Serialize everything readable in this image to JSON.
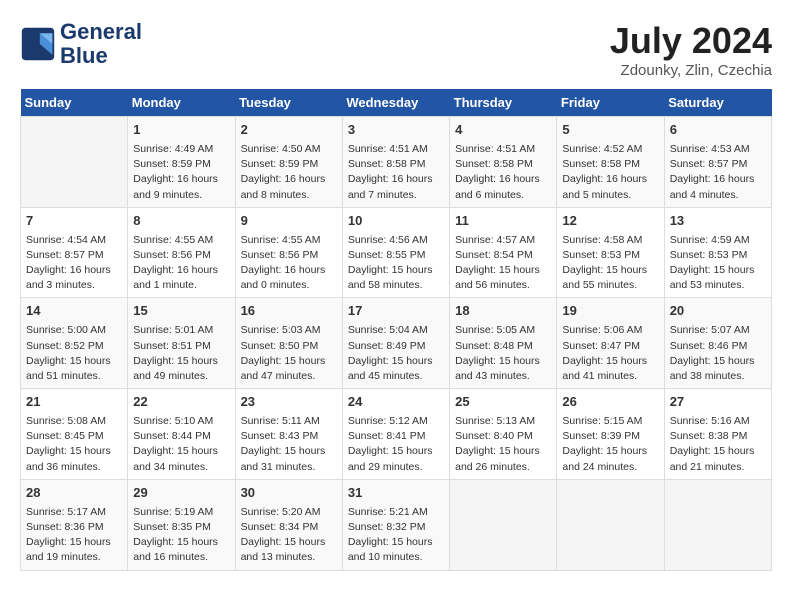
{
  "header": {
    "logo_line1": "General",
    "logo_line2": "Blue",
    "month": "July 2024",
    "location": "Zdounky, Zlin, Czechia"
  },
  "columns": [
    "Sunday",
    "Monday",
    "Tuesday",
    "Wednesday",
    "Thursday",
    "Friday",
    "Saturday"
  ],
  "weeks": [
    [
      {
        "day": "",
        "info": ""
      },
      {
        "day": "1",
        "info": "Sunrise: 4:49 AM\nSunset: 8:59 PM\nDaylight: 16 hours\nand 9 minutes."
      },
      {
        "day": "2",
        "info": "Sunrise: 4:50 AM\nSunset: 8:59 PM\nDaylight: 16 hours\nand 8 minutes."
      },
      {
        "day": "3",
        "info": "Sunrise: 4:51 AM\nSunset: 8:58 PM\nDaylight: 16 hours\nand 7 minutes."
      },
      {
        "day": "4",
        "info": "Sunrise: 4:51 AM\nSunset: 8:58 PM\nDaylight: 16 hours\nand 6 minutes."
      },
      {
        "day": "5",
        "info": "Sunrise: 4:52 AM\nSunset: 8:58 PM\nDaylight: 16 hours\nand 5 minutes."
      },
      {
        "day": "6",
        "info": "Sunrise: 4:53 AM\nSunset: 8:57 PM\nDaylight: 16 hours\nand 4 minutes."
      }
    ],
    [
      {
        "day": "7",
        "info": "Sunrise: 4:54 AM\nSunset: 8:57 PM\nDaylight: 16 hours\nand 3 minutes."
      },
      {
        "day": "8",
        "info": "Sunrise: 4:55 AM\nSunset: 8:56 PM\nDaylight: 16 hours\nand 1 minute."
      },
      {
        "day": "9",
        "info": "Sunrise: 4:55 AM\nSunset: 8:56 PM\nDaylight: 16 hours\nand 0 minutes."
      },
      {
        "day": "10",
        "info": "Sunrise: 4:56 AM\nSunset: 8:55 PM\nDaylight: 15 hours\nand 58 minutes."
      },
      {
        "day": "11",
        "info": "Sunrise: 4:57 AM\nSunset: 8:54 PM\nDaylight: 15 hours\nand 56 minutes."
      },
      {
        "day": "12",
        "info": "Sunrise: 4:58 AM\nSunset: 8:53 PM\nDaylight: 15 hours\nand 55 minutes."
      },
      {
        "day": "13",
        "info": "Sunrise: 4:59 AM\nSunset: 8:53 PM\nDaylight: 15 hours\nand 53 minutes."
      }
    ],
    [
      {
        "day": "14",
        "info": "Sunrise: 5:00 AM\nSunset: 8:52 PM\nDaylight: 15 hours\nand 51 minutes."
      },
      {
        "day": "15",
        "info": "Sunrise: 5:01 AM\nSunset: 8:51 PM\nDaylight: 15 hours\nand 49 minutes."
      },
      {
        "day": "16",
        "info": "Sunrise: 5:03 AM\nSunset: 8:50 PM\nDaylight: 15 hours\nand 47 minutes."
      },
      {
        "day": "17",
        "info": "Sunrise: 5:04 AM\nSunset: 8:49 PM\nDaylight: 15 hours\nand 45 minutes."
      },
      {
        "day": "18",
        "info": "Sunrise: 5:05 AM\nSunset: 8:48 PM\nDaylight: 15 hours\nand 43 minutes."
      },
      {
        "day": "19",
        "info": "Sunrise: 5:06 AM\nSunset: 8:47 PM\nDaylight: 15 hours\nand 41 minutes."
      },
      {
        "day": "20",
        "info": "Sunrise: 5:07 AM\nSunset: 8:46 PM\nDaylight: 15 hours\nand 38 minutes."
      }
    ],
    [
      {
        "day": "21",
        "info": "Sunrise: 5:08 AM\nSunset: 8:45 PM\nDaylight: 15 hours\nand 36 minutes."
      },
      {
        "day": "22",
        "info": "Sunrise: 5:10 AM\nSunset: 8:44 PM\nDaylight: 15 hours\nand 34 minutes."
      },
      {
        "day": "23",
        "info": "Sunrise: 5:11 AM\nSunset: 8:43 PM\nDaylight: 15 hours\nand 31 minutes."
      },
      {
        "day": "24",
        "info": "Sunrise: 5:12 AM\nSunset: 8:41 PM\nDaylight: 15 hours\nand 29 minutes."
      },
      {
        "day": "25",
        "info": "Sunrise: 5:13 AM\nSunset: 8:40 PM\nDaylight: 15 hours\nand 26 minutes."
      },
      {
        "day": "26",
        "info": "Sunrise: 5:15 AM\nSunset: 8:39 PM\nDaylight: 15 hours\nand 24 minutes."
      },
      {
        "day": "27",
        "info": "Sunrise: 5:16 AM\nSunset: 8:38 PM\nDaylight: 15 hours\nand 21 minutes."
      }
    ],
    [
      {
        "day": "28",
        "info": "Sunrise: 5:17 AM\nSunset: 8:36 PM\nDaylight: 15 hours\nand 19 minutes."
      },
      {
        "day": "29",
        "info": "Sunrise: 5:19 AM\nSunset: 8:35 PM\nDaylight: 15 hours\nand 16 minutes."
      },
      {
        "day": "30",
        "info": "Sunrise: 5:20 AM\nSunset: 8:34 PM\nDaylight: 15 hours\nand 13 minutes."
      },
      {
        "day": "31",
        "info": "Sunrise: 5:21 AM\nSunset: 8:32 PM\nDaylight: 15 hours\nand 10 minutes."
      },
      {
        "day": "",
        "info": ""
      },
      {
        "day": "",
        "info": ""
      },
      {
        "day": "",
        "info": ""
      }
    ]
  ]
}
